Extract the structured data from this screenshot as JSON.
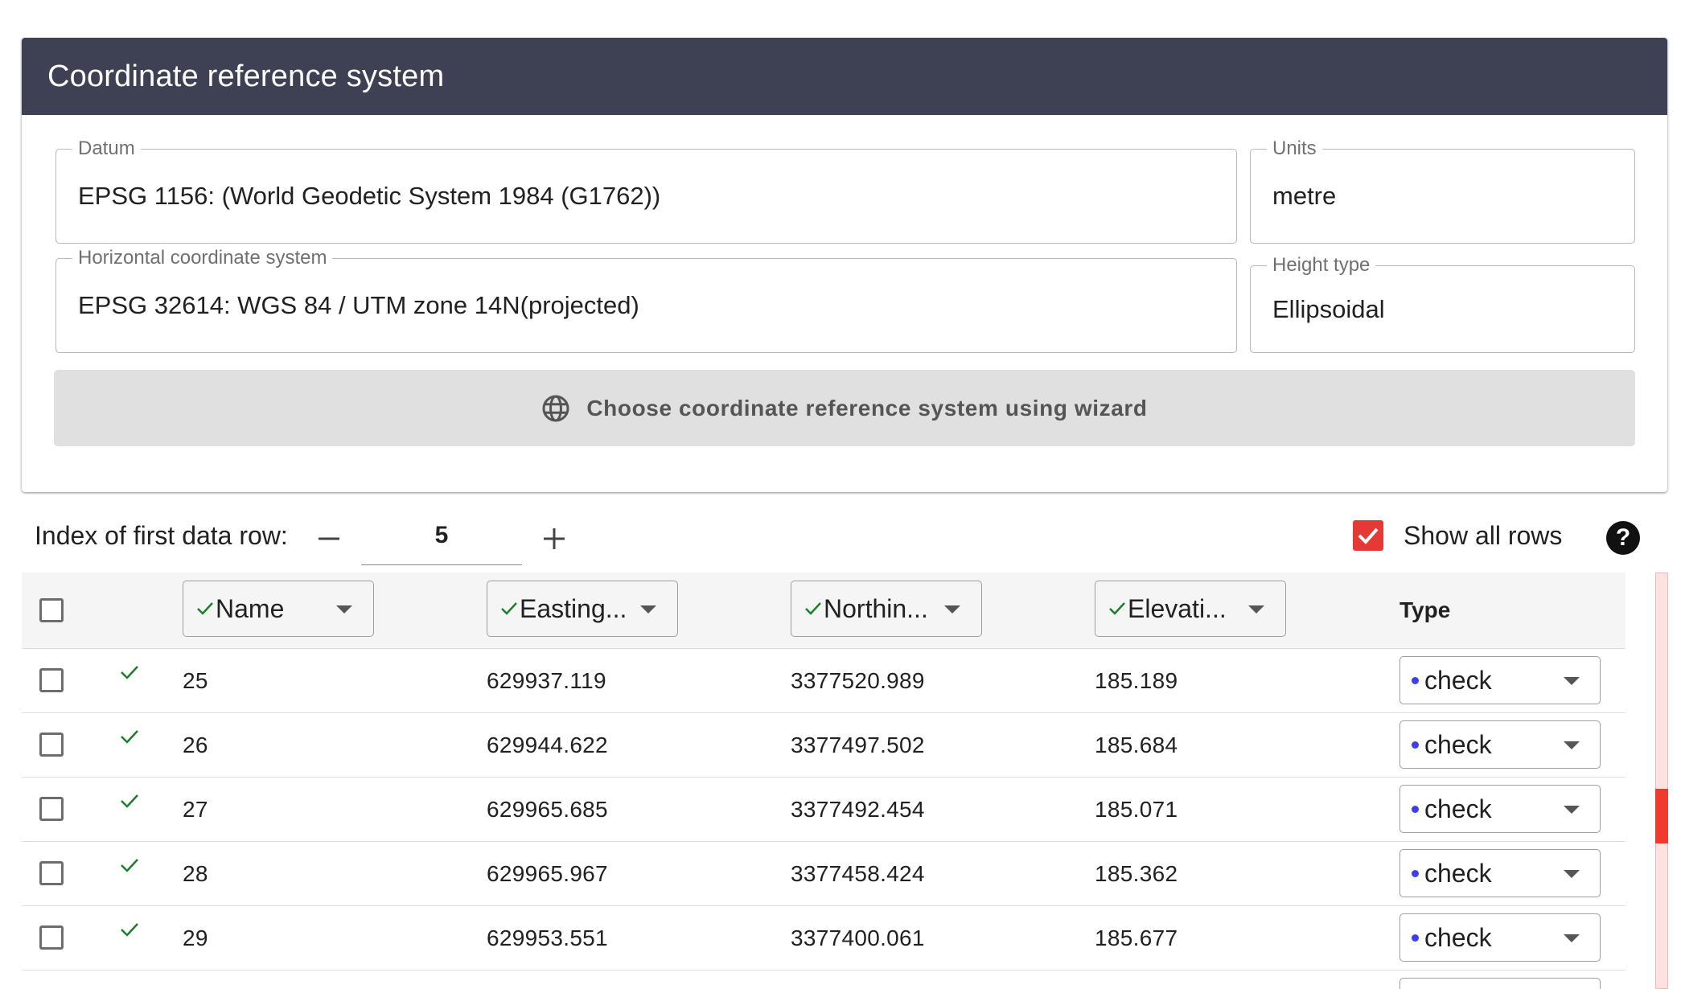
{
  "crs_card": {
    "title": "Coordinate reference system",
    "datum": {
      "label": "Datum",
      "value": "EPSG 1156: (World Geodetic System 1984 (G1762))"
    },
    "units": {
      "label": "Units",
      "value": "metre"
    },
    "horizontal": {
      "label": "Horizontal coordinate system",
      "value": "EPSG 32614: WGS 84 / UTM zone 14N(projected)"
    },
    "height_type": {
      "label": "Height type",
      "value": "Ellipsoidal"
    },
    "wizard_button": {
      "label": "Choose coordinate reference system using wizard",
      "icon": "globe-icon"
    }
  },
  "index_control": {
    "label": "Index of first data row:",
    "value": "5",
    "decrement_icon": "minus-icon",
    "increment_icon": "plus-icon"
  },
  "show_all": {
    "label": "Show all rows",
    "checked": true
  },
  "help": {
    "icon": "help-icon",
    "glyph": "?"
  },
  "table": {
    "columns": [
      {
        "label": "Name",
        "valid": true
      },
      {
        "label": "Easting...",
        "valid": true
      },
      {
        "label": "Northin...",
        "valid": true
      },
      {
        "label": "Elevati...",
        "valid": true
      }
    ],
    "type_header": "Type",
    "rows": [
      {
        "name": "25",
        "easting": "629937.119",
        "northing": "3377520.989",
        "elevation": "185.189",
        "type": "check",
        "valid": true
      },
      {
        "name": "26",
        "easting": "629944.622",
        "northing": "3377497.502",
        "elevation": "185.684",
        "type": "check",
        "valid": true
      },
      {
        "name": "27",
        "easting": "629965.685",
        "northing": "3377492.454",
        "elevation": "185.071",
        "type": "check",
        "valid": true
      },
      {
        "name": "28",
        "easting": "629965.967",
        "northing": "3377458.424",
        "elevation": "185.362",
        "type": "check",
        "valid": true
      },
      {
        "name": "29",
        "easting": "629953.551",
        "northing": "3377400.061",
        "elevation": "185.677",
        "type": "check",
        "valid": true
      }
    ]
  },
  "colors": {
    "header_bg": "#3e4153",
    "valid_check": "#1b7f2a",
    "checkbox_checked": "#e53935",
    "type_dot": "#3d3df5",
    "scroll_thumb": "#ef3b2d"
  }
}
